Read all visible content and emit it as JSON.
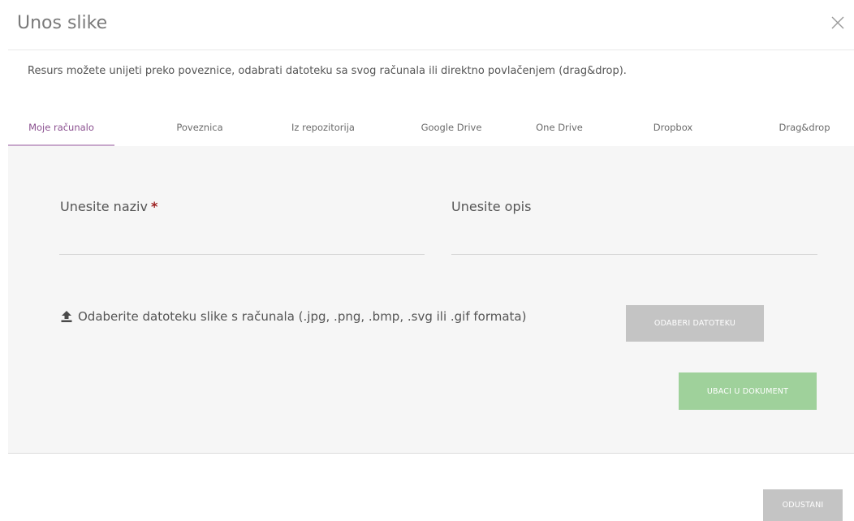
{
  "dialog": {
    "title": "Unos slike",
    "close_icon": "close-icon",
    "intro": "Resurs možete unijeti preko poveznice, odabrati datoteku sa svog računala ili direktno povlačenjem (drag&drop)."
  },
  "tabs": [
    {
      "label": "Moje računalo",
      "active": true
    },
    {
      "label": "Poveznica",
      "active": false
    },
    {
      "label": "Iz repozitorija",
      "active": false
    },
    {
      "label": "Google Drive",
      "active": false
    },
    {
      "label": "One Drive",
      "active": false
    },
    {
      "label": "Dropbox",
      "active": false
    },
    {
      "label": "Drag&drop",
      "active": false
    }
  ],
  "form": {
    "name_label": "Unesite naziv",
    "name_required": "*",
    "name_value": "",
    "description_label": "Unesite opis",
    "description_value": "",
    "upload_icon": "upload-icon",
    "upload_text": "Odaberite datoteku slike s računala (.jpg, .png, .bmp, .svg ili .gif formata)",
    "choose_file_button": "ODABERI DATOTEKU",
    "insert_button": "UBACI U DOKUMENT"
  },
  "footer": {
    "cancel_button": "ODUSTANI"
  },
  "colors": {
    "active_tab": "#8a4f8f",
    "active_tab_underline": "#c7a7cb",
    "required_star": "#9b1c1c",
    "insert_button": "#9fd19b",
    "disabled_button": "#c4c4c4",
    "panel_background": "#f6f6f6"
  }
}
